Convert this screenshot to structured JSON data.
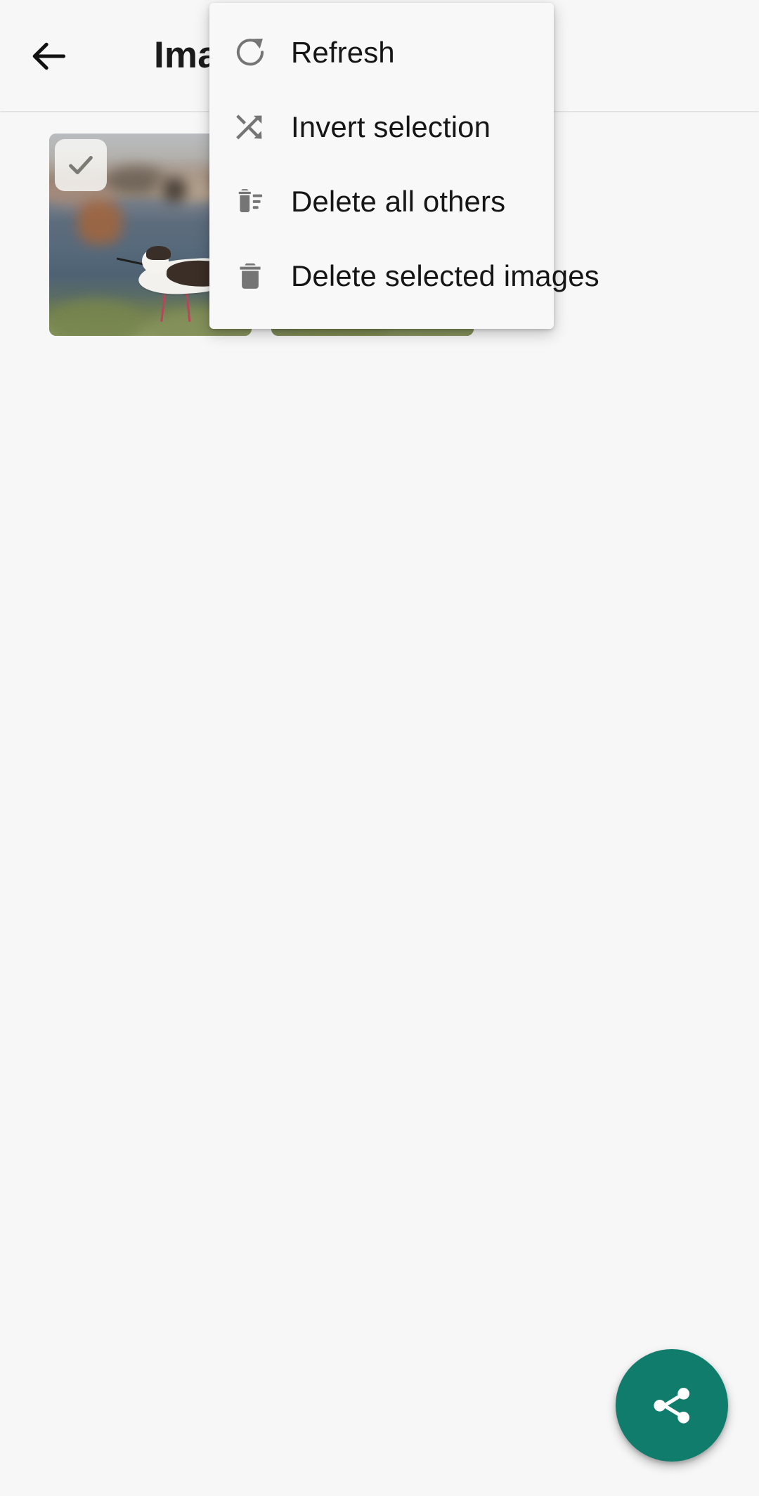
{
  "app_bar": {
    "back_label": "Back",
    "title": "Image s",
    "title_truncated": true
  },
  "theme": {
    "background": "#f7f7f7",
    "surface": "#f8f8f8",
    "accent": "#0f7c6c",
    "text_primary": "#161616",
    "icon_gray": "#757575"
  },
  "gallery": {
    "thumbnails": [
      {
        "id": "thumb-1",
        "alt": "Black-winged stilt wading in shallow water",
        "selected": true,
        "check_icon": "check-icon"
      },
      {
        "id": "thumb-2",
        "alt": "Second image thumbnail, partly covered by menu",
        "selected": false,
        "check_icon": "check-icon"
      }
    ]
  },
  "overflow_menu": {
    "visible": true,
    "items": [
      {
        "label": "Refresh",
        "icon": "refresh-icon"
      },
      {
        "label": "Invert selection",
        "icon": "shuffle-icon"
      },
      {
        "label": "Delete all others",
        "icon": "delete-sweep-icon"
      },
      {
        "label": "Delete selected images",
        "icon": "trash-icon"
      }
    ]
  },
  "fab": {
    "label": "Share",
    "icon": "share-icon",
    "color": "#0f7c6c"
  }
}
